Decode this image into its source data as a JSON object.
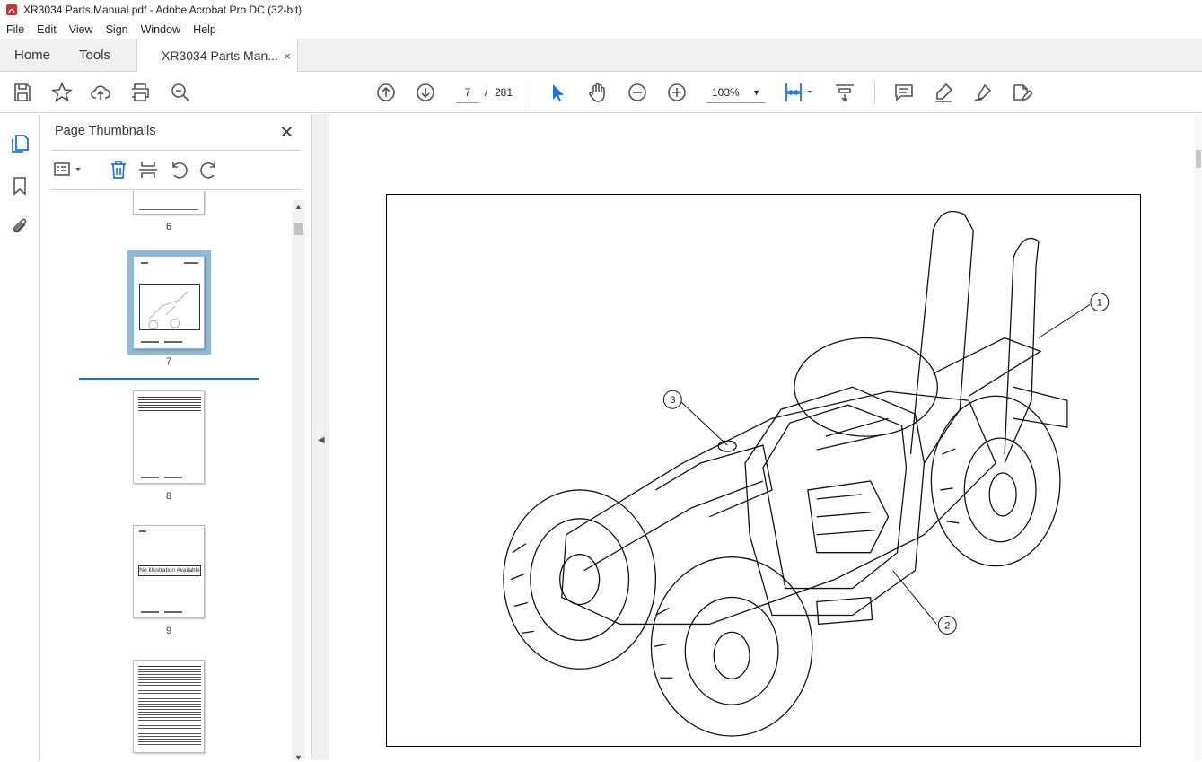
{
  "window": {
    "title": "XR3034 Parts Manual.pdf - Adobe Acrobat Pro DC (32-bit)"
  },
  "menu": [
    "File",
    "Edit",
    "View",
    "Sign",
    "Window",
    "Help"
  ],
  "tabs": {
    "home": "Home",
    "tools": "Tools",
    "document": "XR3034 Parts Man...",
    "close": "×"
  },
  "toolbar": {
    "current_page": "7",
    "separator": "/",
    "total_pages": "281",
    "zoom": "103%"
  },
  "panel": {
    "title": "Page Thumbnails",
    "thumbnails": [
      {
        "label": "6"
      },
      {
        "label": "7",
        "selected": true
      },
      {
        "label": "8"
      },
      {
        "label": "9",
        "text": "No Illustration Available"
      },
      {
        "label": ""
      }
    ]
  },
  "drawing": {
    "callouts": [
      "1",
      "2",
      "3"
    ]
  },
  "colors": {
    "accent": "#1a73e8",
    "selection": "#8fb9d6",
    "pdf_red": "#d32f2f"
  }
}
